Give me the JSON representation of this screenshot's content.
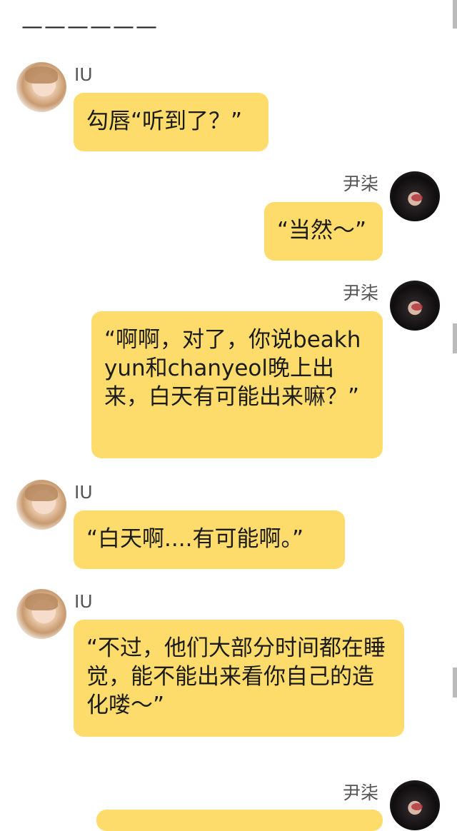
{
  "header": {
    "divider_text": "——————"
  },
  "messages": [
    {
      "sender": "IU",
      "side": "left",
      "text": "勾唇“听到了？”"
    },
    {
      "sender": "尹柒",
      "side": "right",
      "text": "“当然～”"
    },
    {
      "sender": "尹柒",
      "side": "right",
      "text": "“啊啊，对了，你说beakhyun和chanyeol晚上出来，白天有可能出来嘛？”"
    },
    {
      "sender": "IU",
      "side": "left",
      "text": "“白天啊....有可能啊。”"
    },
    {
      "sender": "IU",
      "side": "left",
      "text": "“不过，他们大部分时间都在睡觉，能不能出来看你自己的造化喽～”"
    },
    {
      "sender": "尹柒",
      "side": "right",
      "text": ""
    }
  ],
  "colors": {
    "bubble": "#fddc6c",
    "background": "#ffffff"
  }
}
